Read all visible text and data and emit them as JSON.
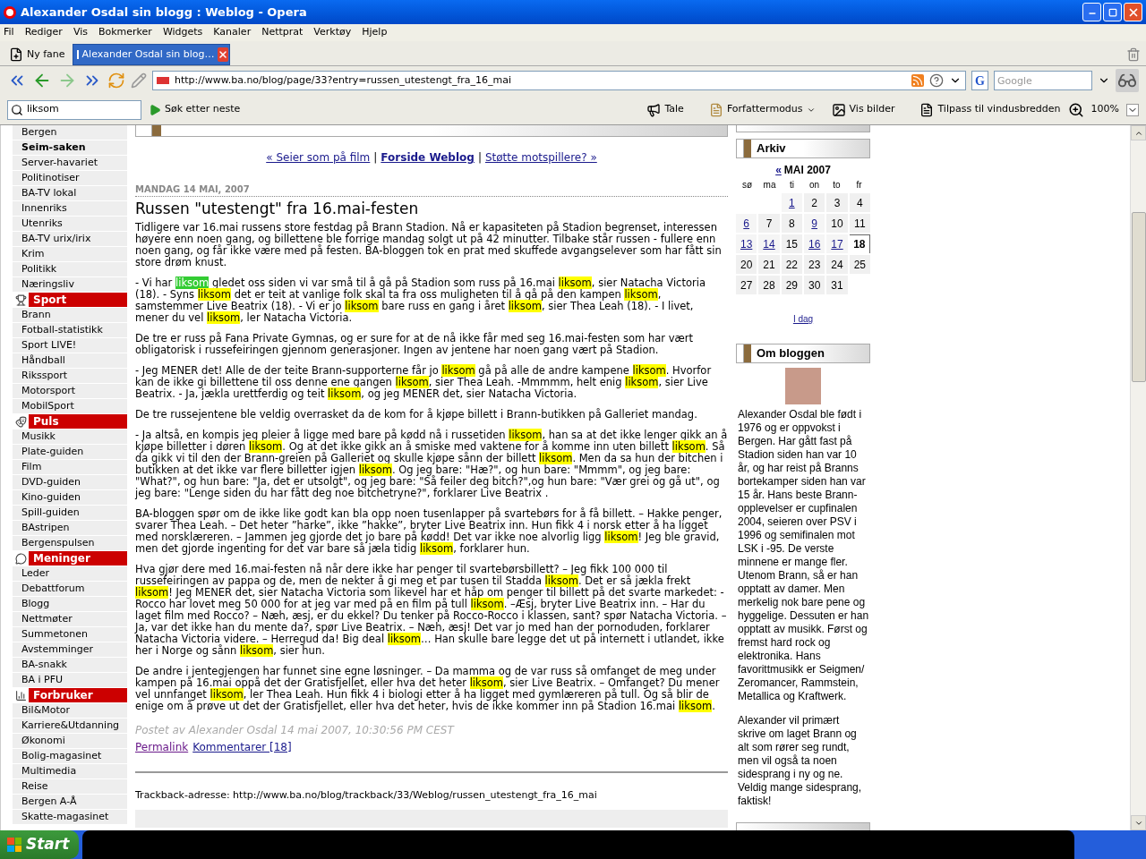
{
  "window": {
    "title": "Alexander Osdal sin blogg : Weblog - Opera"
  },
  "menu": [
    "Fil",
    "Rediger",
    "Vis",
    "Bokmerker",
    "Widgets",
    "Kanaler",
    "Nettprat",
    "Verktøy",
    "Hjelp"
  ],
  "tabs": [
    {
      "label": "Ny fane",
      "selected": false
    },
    {
      "label": "Alexander Osdal sin blog…",
      "selected": true
    }
  ],
  "address_bar": {
    "url": "http://www.ba.no/blog/page/33?entry=russen_utestengt_fra_16_mai"
  },
  "web_search": {
    "logo": "G",
    "placeholder": "Google"
  },
  "find_bar": {
    "value": "liksom",
    "find_next": "Søk etter neste",
    "speak": "Tale",
    "author_mode": "Forfattermodus",
    "show_images": "Vis bilder",
    "fit_to_width": "Tilpass til vindusbredden",
    "zoom": "100%"
  },
  "sidebar": [
    {
      "kind": "link",
      "label": "Bergen"
    },
    {
      "kind": "bold",
      "label": "Seim-saken"
    },
    {
      "kind": "link",
      "label": "Server-havariet"
    },
    {
      "kind": "link",
      "label": "Politinotiser"
    },
    {
      "kind": "link",
      "label": "BA-TV lokal"
    },
    {
      "kind": "link",
      "label": "Innenriks"
    },
    {
      "kind": "link",
      "label": "Utenriks"
    },
    {
      "kind": "link",
      "label": "BA-TV urix/irix"
    },
    {
      "kind": "link",
      "label": "Krim"
    },
    {
      "kind": "link",
      "label": "Politikk"
    },
    {
      "kind": "link",
      "label": "Næringsliv"
    },
    {
      "kind": "section",
      "label": "Sport"
    },
    {
      "kind": "link",
      "label": "Brann"
    },
    {
      "kind": "link",
      "label": "Fotball-statistikk"
    },
    {
      "kind": "link",
      "label": "Sport LIVE!"
    },
    {
      "kind": "link",
      "label": "Håndball"
    },
    {
      "kind": "link",
      "label": "Rikssport"
    },
    {
      "kind": "link",
      "label": "Motorsport"
    },
    {
      "kind": "link",
      "label": "MobilSport"
    },
    {
      "kind": "section",
      "label": "Puls"
    },
    {
      "kind": "link",
      "label": "Musikk"
    },
    {
      "kind": "link",
      "label": "Plate-guiden"
    },
    {
      "kind": "link",
      "label": "Film"
    },
    {
      "kind": "link",
      "label": "DVD-guiden"
    },
    {
      "kind": "link",
      "label": "Kino-guiden"
    },
    {
      "kind": "link",
      "label": "Spill-guiden"
    },
    {
      "kind": "link",
      "label": "BAstripen"
    },
    {
      "kind": "link",
      "label": "Bergenspulsen"
    },
    {
      "kind": "section",
      "label": "Meninger"
    },
    {
      "kind": "link",
      "label": "Leder"
    },
    {
      "kind": "link",
      "label": "Debattforum"
    },
    {
      "kind": "link",
      "label": "Blogg"
    },
    {
      "kind": "link",
      "label": "Nettmøter"
    },
    {
      "kind": "link",
      "label": "Summetonen"
    },
    {
      "kind": "link",
      "label": "Avstemminger"
    },
    {
      "kind": "link",
      "label": "BA-snakk"
    },
    {
      "kind": "link",
      "label": "BA i PFU"
    },
    {
      "kind": "section",
      "label": "Forbruker"
    },
    {
      "kind": "link",
      "label": "Bil&Motor"
    },
    {
      "kind": "link",
      "label": "Karriere&Utdanning"
    },
    {
      "kind": "link",
      "label": "Økonomi"
    },
    {
      "kind": "link",
      "label": "Bolig-magasinet"
    },
    {
      "kind": "link",
      "label": "Multimedia"
    },
    {
      "kind": "link",
      "label": "Reise"
    },
    {
      "kind": "link",
      "label": "Bergen A-Å"
    },
    {
      "kind": "link",
      "label": "Skatte-magasinet"
    }
  ],
  "post": {
    "nav": [
      {
        "kind": "link",
        "text": "« Seier som på film"
      },
      {
        "kind": "separator",
        "text": "|"
      },
      {
        "kind": "home",
        "text": "Forside Weblog"
      },
      {
        "kind": "separator",
        "text": "|"
      },
      {
        "kind": "link",
        "text": "Støtte motspillere? »"
      }
    ],
    "date": "MANDAG 14 MAI, 2007",
    "title": "Russen \"utestengt\" fra 16.mai-festen",
    "paragraphs": [
      [
        "Tidligere var 16.mai russens store festdag på Brann Stadion. Nå er kapasiteten på Stadion begrenset, interessen høyere enn noen gang, og billettene ble forrige mandag solgt ut på 42 minutter. Tilbake står russen - fullere enn noen gang, og får ikke være med på festen. BA-bloggen tok en prat med skuffede avgangselever som har fått sin store drøm knust."
      ],
      [
        "- Vi har ",
        {
          "text": "liksom",
          "current": true
        },
        " gledet oss siden vi var små til å gå på Stadion som russ på 16.mai ",
        {
          "text": "liksom",
          "current": false
        },
        ", sier Natacha Victoria (18). - Syns ",
        {
          "text": "liksom",
          "current": false
        },
        " det er teit at vanlige folk skal ta fra oss muligheten til å gå på den kampen ",
        {
          "text": "liksom",
          "current": false
        },
        ", samstemmer Live Beatrix (18). - Vi er jo ",
        {
          "text": "liksom",
          "current": false
        },
        " bare russ en gang i året ",
        {
          "text": "liksom",
          "current": false
        },
        ", sier Thea Leah (18). - I livet, mener du vel ",
        {
          "text": "liksom",
          "current": false
        },
        ", ler Natacha Victoria."
      ],
      [
        "De tre er russ på Fana Private Gymnas, og er sure for at de nå ikke får med seg 16.mai-festen som har vært obligatorisk i russefeiringen gjennom generasjoner. Ingen av jentene har noen gang vært på Stadion."
      ],
      [
        "- Jeg MENER det! Alle de der teite Brann-supporterne får jo ",
        {
          "text": "liksom",
          "current": false
        },
        " gå på alle de andre kampene ",
        {
          "text": "liksom",
          "current": false
        },
        ". Hvorfor kan de ikke gi billettene til oss denne ene gangen ",
        {
          "text": "liksom",
          "current": false
        },
        ", sier Thea Leah. -Mmmmm, helt enig ",
        {
          "text": "liksom",
          "current": false
        },
        ", sier Live Beatrix. - Ja, jækla urettferdig og teit ",
        {
          "text": "liksom",
          "current": false
        },
        ", og jeg MENER det, sier Natacha Victoria."
      ],
      [
        "De tre russejentene ble veldig overrasket da de kom for å kjøpe billett i Brann-butikken på Galleriet mandag."
      ],
      [
        "- Ja altså, en kompis jeg pleier å ligge med bare på kødd nå i russetiden ",
        {
          "text": "liksom",
          "current": false
        },
        ", han sa at det ikke lenger gikk an å kjøpe billetter i døren ",
        {
          "text": "liksom",
          "current": false
        },
        ". Og at det ikke gikk an å smiske med vaktene for å komme inn uten billett ",
        {
          "text": "liksom",
          "current": false
        },
        ". Så da gikk vi til den der Brann-greien på Galleriet og skulle kjøpe sånn der billett ",
        {
          "text": "liksom",
          "current": false
        },
        ". Men da sa hun der bitchen i butikken at det ikke var flere billetter igjen ",
        {
          "text": "liksom",
          "current": false
        },
        ". Og jeg bare: \"Hæ?\", og hun bare: \"Mmmm\", og jeg bare: \"What?\", og hun bare: \"Ja, det er utsolgt\", og jeg bare: \"Så feiler deg bitch?\",og hun bare: \"Vær grei og gå ut\", og jeg bare: \"Lenge siden du har fått deg noe bitchetryne?\", forklarer Live Beatrix ."
      ],
      [
        "BA-bloggen spør om de ikke like godt kan bla opp noen tusenlapper på svartebørs for å få billett. – Hakke penger, svarer Thea Leah. – Det heter ”harke”, ikke ”hakke”, bryter Live Beatrix inn. Hun fikk 4 i norsk etter å ha ligget med norsklæreren. – Jammen jeg gjorde det jo bare på kødd! Det var ikke noe alvorlig ligg ",
        {
          "text": "liksom",
          "current": false
        },
        "! Jeg ble gravid, men det gjorde ingenting for det var bare så jæla tidig ",
        {
          "text": "liksom",
          "current": false
        },
        ", forklarer hun."
      ],
      [
        "Hva gjør dere med 16.mai-festen nå når dere ikke har penger til svartebørsbillett? – Jeg fikk 100 000 til russefeiringen av pappa og de, men de nekter å gi meg et par tusen til Stadda ",
        {
          "text": "liksom",
          "current": false
        },
        ". Det er så jækla frekt ",
        {
          "text": "liksom",
          "current": false
        },
        "! Jeg MENER det, sier Natacha Victoria som likevel har et håp om penger til billett på det svarte markedet: - Rocco har lovet meg 50 000 for at jeg var med på en film på tull ",
        {
          "text": "liksom",
          "current": false
        },
        ". –Æsj, bryter Live Beatrix inn. – Har du laget film med Rocco? – Næh, æsj, er du ekkel? Du tenker på Rocco-Rocco i klassen, sant? spør Natacha Victoria. – Ja, var det ikke han du mente da?, spør Live Beatrix. – Næh, æsj! Det var jo med han der pornoduden, forklarer Natacha Victoria videre. – Herregud da! Big deal ",
        {
          "text": "liksom",
          "current": false
        },
        "… Han skulle bare legge det ut på internett i utlandet, ikke her i Norge og sånn ",
        {
          "text": "liksom",
          "current": false
        },
        ", sier hun."
      ],
      [
        "De andre i jentegjengen har funnet sine egne løsninger. – Da mamma og de var russ så omfanget de meg under kampen på 16.mai oppå det der Gratisfjellet, eller hva det heter ",
        {
          "text": "liksom",
          "current": false
        },
        ", sier Live Beatrix. – Omfanget? Du mener vel unnfanget ",
        {
          "text": "liksom",
          "current": false
        },
        ", ler Thea Leah. Hun fikk 4 i biologi etter å ha ligget med gymlæreren på tull. Og så blir de enige om å prøve ut det der Gratisfjellet, eller hva det heter, hvis de ikke kommer inn på Stadion 16.mai ",
        {
          "text": "liksom",
          "current": false
        },
        "."
      ]
    ],
    "byline": "Postet av Alexander Osdal 14 mai 2007, 10:30:56 PM CEST",
    "links": [
      {
        "text": "Permalink",
        "visited": true
      },
      {
        "text": "Kommentarer [18]",
        "visited": false
      }
    ],
    "trackback": "Trackback-adresse: http://www.ba.no/blog/trackback/33/Weblog/russen_utestengt_fra_16_mai"
  },
  "archive": {
    "title": "Arkiv",
    "prev": "«",
    "month": "MAI 2007",
    "weekdays": [
      "sø",
      "ma",
      "ti",
      "on",
      "to",
      "fr"
    ],
    "weeks": [
      [
        {
          "kind": "blank"
        },
        {
          "kind": "blank"
        },
        {
          "kind": "day",
          "day": "1",
          "linked": true,
          "today": false
        },
        {
          "kind": "day",
          "day": "2",
          "linked": false,
          "today": false
        },
        {
          "kind": "day",
          "day": "3",
          "linked": false,
          "today": false
        },
        {
          "kind": "day",
          "day": "4",
          "linked": false,
          "today": false
        }
      ],
      [
        {
          "kind": "day",
          "day": "6",
          "linked": true,
          "today": false
        },
        {
          "kind": "day",
          "day": "7",
          "linked": false,
          "today": false
        },
        {
          "kind": "day",
          "day": "8",
          "linked": false,
          "today": false
        },
        {
          "kind": "day",
          "day": "9",
          "linked": true,
          "today": false
        },
        {
          "kind": "day",
          "day": "10",
          "linked": false,
          "today": false
        },
        {
          "kind": "day",
          "day": "11",
          "linked": false,
          "today": false
        }
      ],
      [
        {
          "kind": "day",
          "day": "13",
          "linked": true,
          "today": false
        },
        {
          "kind": "day",
          "day": "14",
          "linked": true,
          "today": false
        },
        {
          "kind": "day",
          "day": "15",
          "linked": false,
          "today": false
        },
        {
          "kind": "day",
          "day": "16",
          "linked": true,
          "today": false
        },
        {
          "kind": "day",
          "day": "17",
          "linked": true,
          "today": false
        },
        {
          "kind": "day",
          "day": "18",
          "linked": false,
          "today": true
        }
      ],
      [
        {
          "kind": "day",
          "day": "20",
          "linked": false,
          "today": false
        },
        {
          "kind": "day",
          "day": "21",
          "linked": false,
          "today": false
        },
        {
          "kind": "day",
          "day": "22",
          "linked": false,
          "today": false
        },
        {
          "kind": "day",
          "day": "23",
          "linked": false,
          "today": false
        },
        {
          "kind": "day",
          "day": "24",
          "linked": false,
          "today": false
        },
        {
          "kind": "day",
          "day": "25",
          "linked": false,
          "today": false
        }
      ],
      [
        {
          "kind": "day",
          "day": "27",
          "linked": false,
          "today": false
        },
        {
          "kind": "day",
          "day": "28",
          "linked": false,
          "today": false
        },
        {
          "kind": "day",
          "day": "29",
          "linked": false,
          "today": false
        },
        {
          "kind": "day",
          "day": "30",
          "linked": false,
          "today": false
        },
        {
          "kind": "day",
          "day": "31",
          "linked": false,
          "today": false
        }
      ]
    ],
    "today_link": "I dag"
  },
  "about": {
    "title": "Om bloggen",
    "paragraphs": [
      "Alexander Osdal ble født i 1976 og er oppvokst i Bergen. Har gått fast på Stadion siden han var 10 år, og har reist på Branns bortekamper siden han var 15 år. Hans beste Brann-opplevelser er  cupfinalen 2004, seieren over PSV i 1996 og semifinalen mot LSK i -95. De verste minnene er mange fler. Utenom Brann, så er han opptatt av damer. Men merkelig nok bare pene og hyggelige. Dessuten er han opptatt av musikk. Først og fremst hard rock og elektronika. Hans favorittmusikk er Seigmen/ Zeromancer, Rammstein, Metallica og Kraftwerk.",
      "Alexander vil primært skrive om laget Brann og alt som rører seg rundt, men vil også ta noen sidesprang i ny og ne. Veldig mange sidesprang, faktisk!"
    ]
  },
  "taskbar": {
    "start": "Start"
  }
}
